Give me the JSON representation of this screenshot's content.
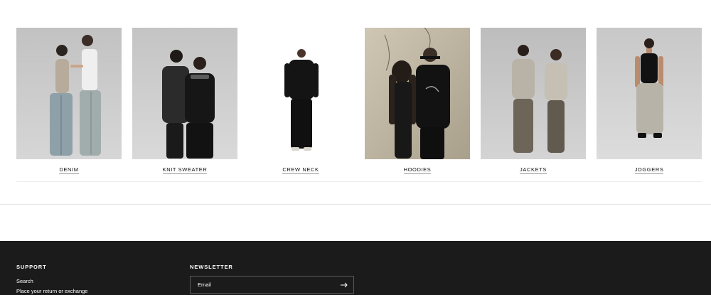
{
  "collections": [
    {
      "label": "DENIM"
    },
    {
      "label": "KNIT SWEATER"
    },
    {
      "label": "CREW NECK"
    },
    {
      "label": "HOODIES"
    },
    {
      "label": "JACKETS"
    },
    {
      "label": "JOGGERS"
    }
  ],
  "footer": {
    "support": {
      "heading": "SUPPORT",
      "links": [
        "Search",
        "Place your return or exchange"
      ]
    },
    "newsletter": {
      "heading": "NEWSLETTER",
      "placeholder": "Email",
      "submit_icon": "arrow-right-icon"
    }
  },
  "colors": {
    "footer_bg": "#1b1b1b",
    "studio_grey": "#c9c9c9",
    "text": "#111111"
  }
}
